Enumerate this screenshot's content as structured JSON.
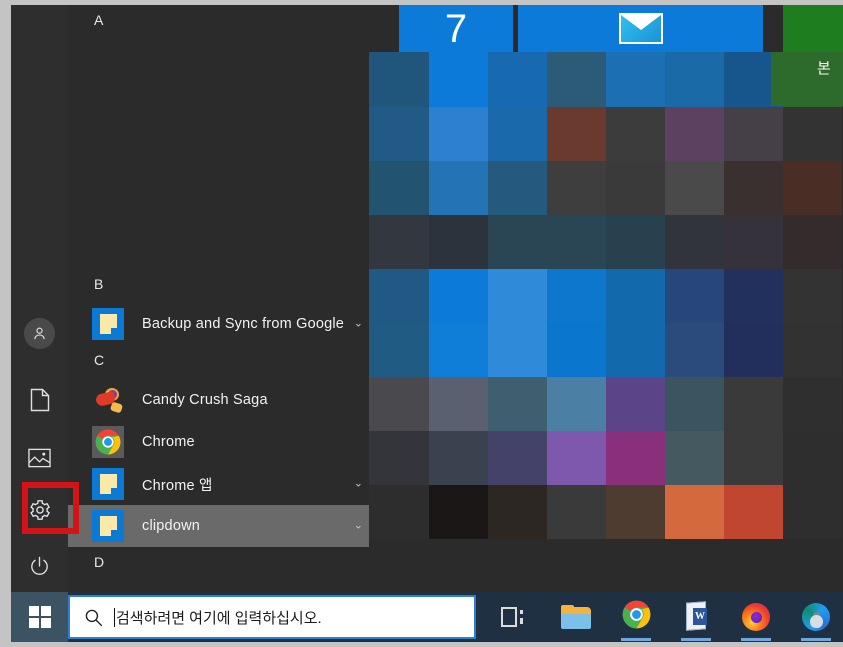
{
  "window": {
    "title": "Windows 10 Start Menu"
  },
  "rail": {
    "items": [
      {
        "id": "account",
        "name": "user-account",
        "icon": "user-icon"
      },
      {
        "id": "documents",
        "name": "documents",
        "icon": "document-icon"
      },
      {
        "id": "pictures",
        "name": "pictures",
        "icon": "pictures-icon"
      },
      {
        "id": "settings",
        "name": "settings",
        "icon": "gear-icon",
        "highlighted": true
      },
      {
        "id": "power",
        "name": "power",
        "icon": "power-icon"
      }
    ],
    "highlight_color": "#d41217"
  },
  "app_list": {
    "groups": [
      {
        "letter": "A",
        "apps": []
      },
      {
        "letter": "B",
        "apps": [
          {
            "label": "Backup and Sync from Google",
            "icon": "folder-icon",
            "expandable": true,
            "hovered": false
          }
        ]
      },
      {
        "letter": "C",
        "apps": [
          {
            "label": "Candy Crush Saga",
            "icon": "candy-crush-icon",
            "expandable": false,
            "hovered": false
          },
          {
            "label": "Chrome",
            "icon": "chrome-icon",
            "expandable": false,
            "hovered": false
          },
          {
            "label": "Chrome 앱",
            "icon": "folder-icon",
            "expandable": true,
            "hovered": false
          },
          {
            "label": "clipdown",
            "icon": "folder-icon",
            "expandable": true,
            "hovered": true
          }
        ]
      },
      {
        "letter": "D",
        "apps": []
      }
    ],
    "expand_chevron": "⌄"
  },
  "tiles": {
    "calendar_day": "7",
    "mail_tile": "mail-tile",
    "green_tile_label": "본"
  },
  "taskbar": {
    "start_button": "start-button",
    "search": {
      "placeholder": "검색하려면 여기에 입력하십시오.",
      "value": ""
    },
    "items": [
      {
        "name": "task-view",
        "label": "Task View",
        "running": false
      },
      {
        "name": "file-explorer",
        "label": "File Explorer",
        "running": false
      },
      {
        "name": "google-chrome",
        "label": "Chrome",
        "running": true
      },
      {
        "name": "microsoft-word",
        "label": "Word",
        "running": true
      },
      {
        "name": "mozilla-firefox",
        "label": "Firefox",
        "running": true
      },
      {
        "name": "microsoft-edge",
        "label": "Edge",
        "running": true
      }
    ]
  },
  "colors": {
    "menu_bg": "#2b2b2b",
    "rail_bg": "#2e2e2e",
    "taskbar_bg": "#1f3043",
    "accent_blue": "#0b7ad8",
    "hover_row": "#6a6a6a",
    "highlight_red": "#d41217"
  }
}
